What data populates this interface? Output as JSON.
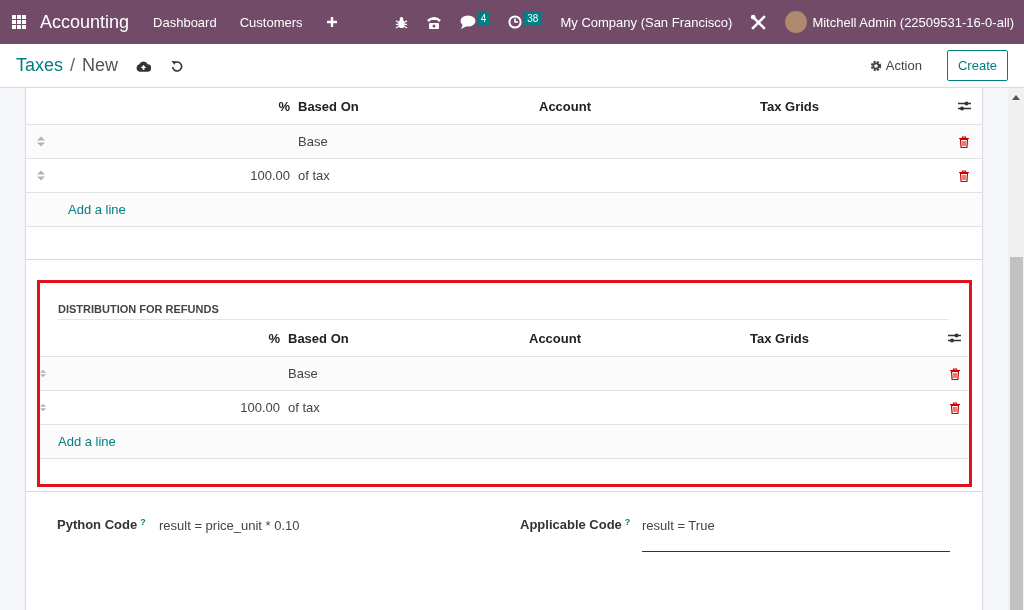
{
  "navbar": {
    "app_name": "Accounting",
    "menu": [
      "Dashboard",
      "Customers"
    ],
    "messages_count": "4",
    "activities_count": "38",
    "company": "My Company (San Francisco)",
    "user": "Mitchell Admin (22509531-16-0-all)"
  },
  "breadcrumb": {
    "parent": "Taxes",
    "separator": "/",
    "current": "New"
  },
  "actions": {
    "action": "Action",
    "create": "Create"
  },
  "tables": [
    {
      "highlighted": false,
      "columns": [
        "%",
        "Based On",
        "Account",
        "Tax Grids"
      ],
      "rows": [
        {
          "based_on": "Base"
        },
        {
          "percent": "100.00",
          "based_on": "of tax"
        }
      ],
      "add_line": "Add a line"
    },
    {
      "highlighted": true,
      "title": "DISTRIBUTION FOR REFUNDS",
      "columns": [
        "%",
        "Based On",
        "Account",
        "Tax Grids"
      ],
      "rows": [
        {
          "based_on": "Base"
        },
        {
          "percent": "100.00",
          "based_on": "of tax"
        }
      ],
      "add_line": "Add a line"
    }
  ],
  "fields": [
    {
      "label": "Python Code",
      "help": "?",
      "value": "result = price_unit * 0.10",
      "focused": false
    },
    {
      "label": "Applicable Code",
      "help": "?",
      "value": "result = True",
      "focused": true
    }
  ]
}
